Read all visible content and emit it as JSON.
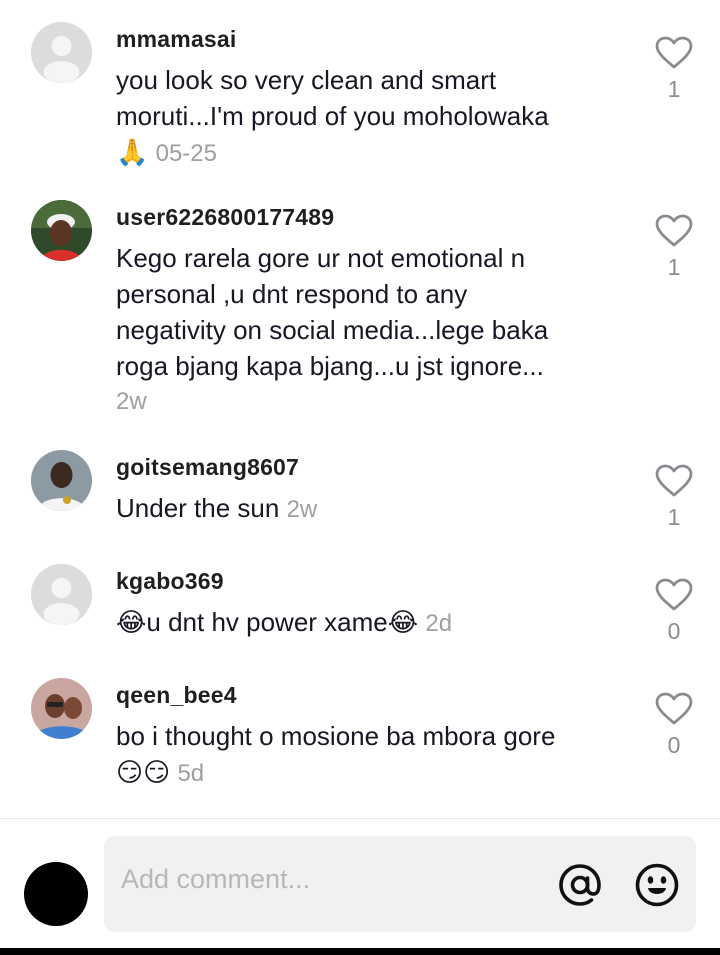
{
  "comments": [
    {
      "username": "mmamasai",
      "text_lines": [
        "you look so very clean and smart",
        "moruti...I'm proud of you moholowaka"
      ],
      "trailing_emoji": "🙏",
      "time": "05-25",
      "likes": "1",
      "avatar": "default-avatar"
    },
    {
      "username": "user6226800177489",
      "text_lines": [
        "Kego rarela gore ur not emotional n",
        "personal ,u dnt respond to any",
        "negativity on social media...lege baka",
        "roga bjang kapa bjang...u jst ignore..."
      ],
      "time": "2w",
      "likes": "1",
      "avatar": "photo-man-cap"
    },
    {
      "username": "goitsemang8607",
      "text": "Under the sun",
      "time": "2w",
      "likes": "1",
      "avatar": "photo-man-shirt"
    },
    {
      "username": "kgabo369",
      "emoji_before": "😂",
      "text": "u dnt hv power xame",
      "emoji_after": "😂",
      "time": "2d",
      "likes": "0",
      "avatar": "default-avatar"
    },
    {
      "username": "qeen_bee4",
      "text": "bo i thought o mosione ba mbora gore",
      "emoji_line": "😏😏",
      "time": "5d",
      "likes": "0",
      "avatar": "photo-woman"
    }
  ],
  "composer": {
    "placeholder": "Add comment...",
    "mention_icon": "at-icon",
    "emoji_icon": "smiley-icon"
  },
  "colors": {
    "text": "#161823",
    "muted": "#9e9ea3",
    "input_bg": "#f1f1f2",
    "heart_stroke": "#8a8b91"
  }
}
